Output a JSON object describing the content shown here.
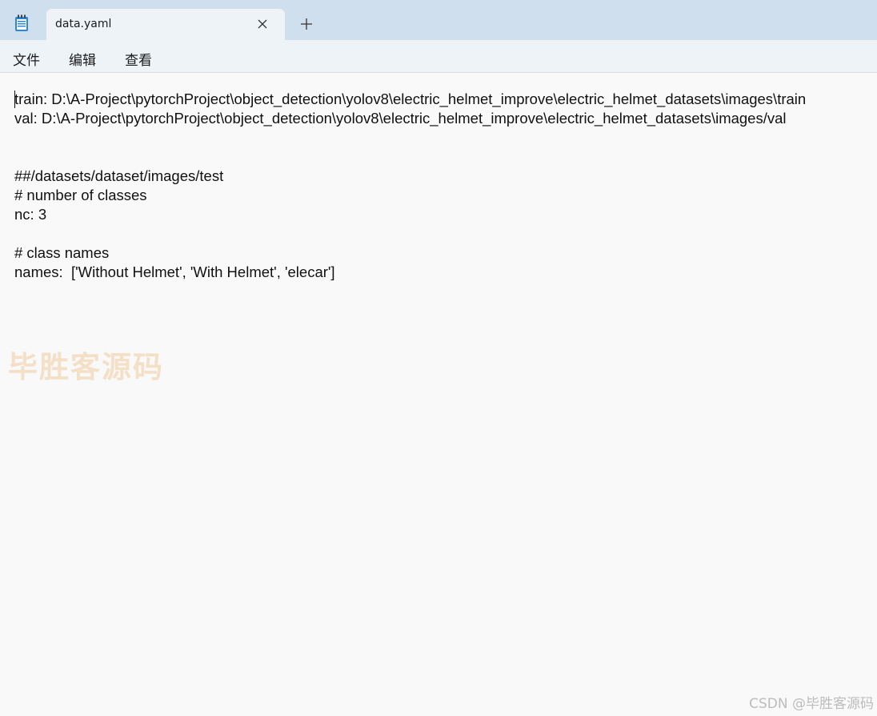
{
  "window": {
    "app_icon": "notepad-icon",
    "tab": {
      "title": "data.yaml",
      "close_icon": "close-icon"
    },
    "new_tab_icon": "plus-icon"
  },
  "menu": {
    "items": [
      {
        "label": "文件"
      },
      {
        "label": "编辑"
      },
      {
        "label": "查看"
      }
    ]
  },
  "editor": {
    "lines": [
      "train: D:\\A-Project\\pytorchProject\\object_detection\\yolov8\\electric_helmet_improve\\electric_helmet_datasets\\images\\train",
      "val: D:\\A-Project\\pytorchProject\\object_detection\\yolov8\\electric_helmet_improve\\electric_helmet_datasets\\images/val",
      "",
      "",
      "##/datasets/dataset/images/test",
      "# number of classes",
      "nc: 3",
      "",
      "# class names",
      "names:  ['Without Helmet', 'With Helmet', 'elecar']"
    ]
  },
  "watermark": {
    "logo_text": "毕胜客源码",
    "credit": "CSDN @毕胜客源码"
  },
  "colors": {
    "titlebar_bg": "#cfdfed",
    "tab_bg": "#eef3f8",
    "editor_bg": "#f9f9f9",
    "text": "#111111"
  }
}
